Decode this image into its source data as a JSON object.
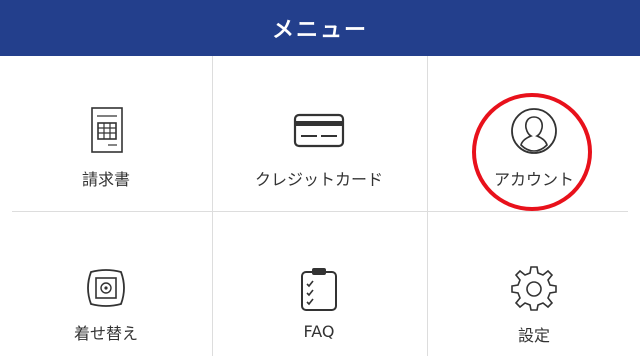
{
  "header": {
    "title": "メニュー",
    "color": "#233f8c"
  },
  "menu": {
    "items": [
      {
        "label": "請求書",
        "icon": "invoice-icon"
      },
      {
        "label": "クレジットカード",
        "icon": "credit-card-icon"
      },
      {
        "label": "アカウント",
        "icon": "account-icon"
      },
      {
        "label": "着せ替え",
        "icon": "theme-frame-icon"
      },
      {
        "label": "FAQ",
        "icon": "clipboard-checklist-icon"
      },
      {
        "label": "設定",
        "icon": "gear-icon"
      }
    ]
  },
  "annotation": {
    "highlight_color": "#e8111b",
    "highlighted_item": "アカウント"
  }
}
